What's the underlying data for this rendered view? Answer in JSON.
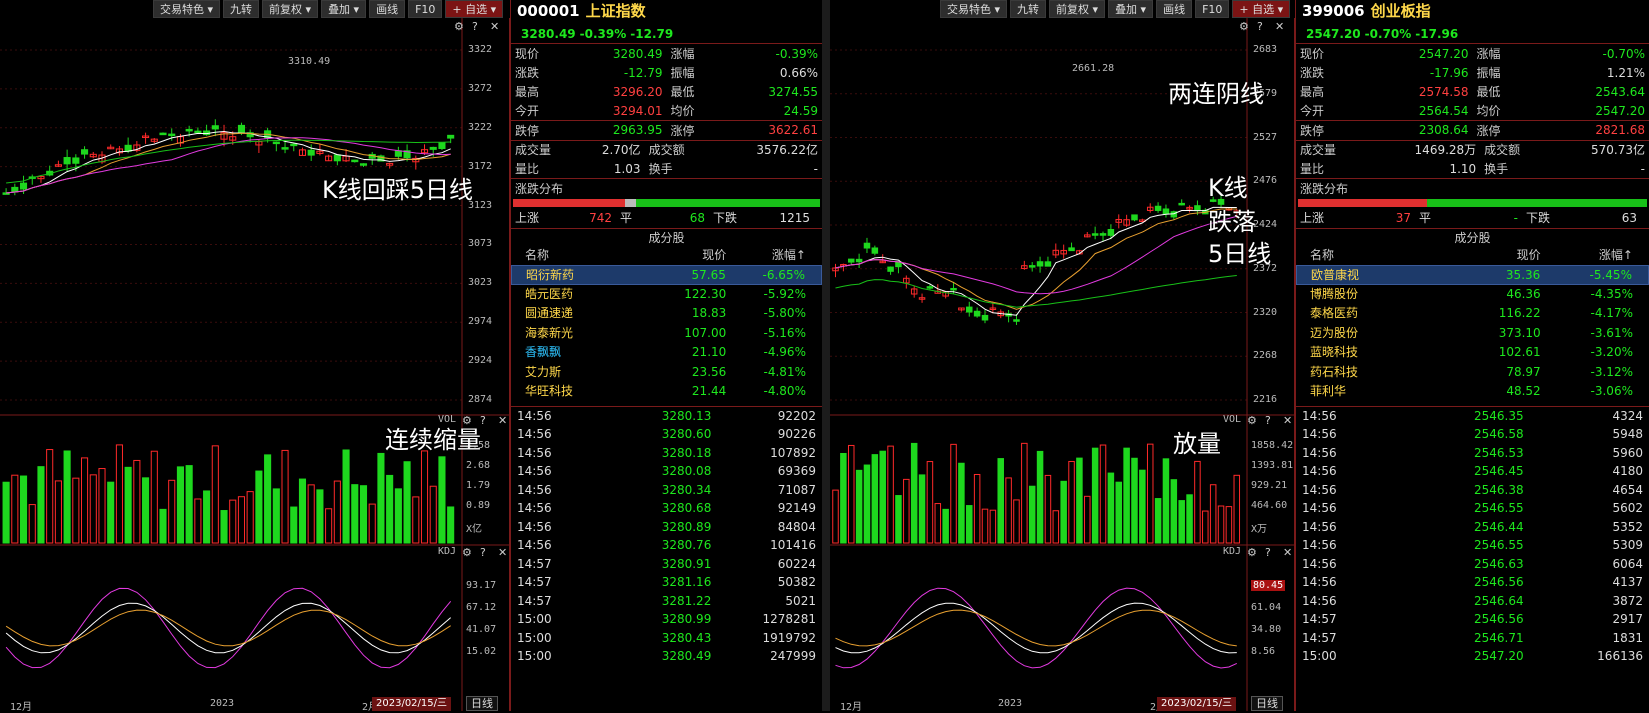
{
  "left": {
    "toolbar": [
      "交易特色 ▾",
      "九转",
      "前复权 ▾",
      "叠加 ▾",
      "画线",
      "F10"
    ],
    "toolbar_add": "+ 自选 ▾",
    "code": "000001",
    "name": "上证指数",
    "price_line": {
      "price": "3280.49",
      "pct": "-0.39%",
      "chg": "-12.79"
    },
    "peak_label": "3310.49",
    "y_labels": [
      "3322",
      "3272",
      "3222",
      "3172",
      "3123",
      "3073",
      "3023",
      "2974",
      "2924",
      "2874"
    ],
    "vol_labels": [
      "3.58",
      "2.68",
      "1.79",
      "0.89",
      "X亿"
    ],
    "kdj_labels": [
      "93.17",
      "67.12",
      "41.07",
      "15.02"
    ],
    "date_labels": [
      "12月",
      "2023",
      "2月"
    ],
    "date_box": "2023/02/15/三",
    "period": "日线",
    "vol_tag": "VOL",
    "kdj_tag": "KDJ",
    "annotations": {
      "k": "K线回踩5日线",
      "vol": "连续缩量"
    },
    "quote": [
      {
        "k1": "现价",
        "v1": "3280.49",
        "c1": "g",
        "k2": "涨幅",
        "v2": "-0.39%",
        "c2": "g"
      },
      {
        "k1": "涨跌",
        "v1": "-12.79",
        "c1": "g",
        "k2": "振幅",
        "v2": "0.66%",
        "c2": "w"
      },
      {
        "k1": "最高",
        "v1": "3296.20",
        "c1": "r",
        "k2": "最低",
        "v2": "3274.55",
        "c2": "g"
      },
      {
        "k1": "今开",
        "v1": "3294.01",
        "c1": "r",
        "k2": "均价",
        "v2": "24.59",
        "c2": "g"
      }
    ],
    "limit": {
      "k1": "跌停",
      "v1": "2963.95",
      "k2": "涨停",
      "v2": "3622.61"
    },
    "volume": {
      "k1": "成交量",
      "v1": "2.70亿",
      "k2": "成交额",
      "v2": "3576.22亿",
      "k3": "量比",
      "v3": "1.03",
      "k4": "换手",
      "v4": "-"
    },
    "dist": {
      "title": "涨跌分布",
      "up_label": "上涨",
      "up": "742",
      "flat_label": "平",
      "flat": "68",
      "down_label": "下跌",
      "down": "1215"
    },
    "stocks_title": "成分股",
    "stocks_header": [
      "名称",
      "现价",
      "涨幅↑"
    ],
    "stocks": [
      {
        "n": "昭衍新药",
        "p": "57.65",
        "c": "-6.65%",
        "nc": "y"
      },
      {
        "n": "皓元医药",
        "p": "122.30",
        "c": "-5.92%",
        "nc": "y"
      },
      {
        "n": "圆通速递",
        "p": "18.83",
        "c": "-5.80%",
        "nc": "y"
      },
      {
        "n": "海泰新光",
        "p": "107.00",
        "c": "-5.16%",
        "nc": "y"
      },
      {
        "n": "香飘飘",
        "p": "21.10",
        "c": "-4.96%",
        "nc": "c"
      },
      {
        "n": "艾力斯",
        "p": "23.56",
        "c": "-4.81%",
        "nc": "y"
      },
      {
        "n": "华旺科技",
        "p": "21.44",
        "c": "-4.80%",
        "nc": "y"
      }
    ],
    "ticks": [
      [
        "14:56",
        "3280.13",
        "92202"
      ],
      [
        "14:56",
        "3280.60",
        "90226"
      ],
      [
        "14:56",
        "3280.18",
        "107892"
      ],
      [
        "14:56",
        "3280.08",
        "69369"
      ],
      [
        "14:56",
        "3280.34",
        "71087"
      ],
      [
        "14:56",
        "3280.68",
        "92149"
      ],
      [
        "14:56",
        "3280.89",
        "84804"
      ],
      [
        "14:56",
        "3280.76",
        "101416"
      ],
      [
        "14:57",
        "3280.91",
        "60224"
      ],
      [
        "14:57",
        "3281.16",
        "50382"
      ],
      [
        "14:57",
        "3281.22",
        "5021"
      ],
      [
        "15:00",
        "3280.99",
        "1278281"
      ],
      [
        "15:00",
        "3280.43",
        "1919792"
      ],
      [
        "15:00",
        "3280.49",
        "247999"
      ]
    ]
  },
  "right": {
    "toolbar": [
      "交易特色 ▾",
      "九转",
      "前复权 ▾",
      "叠加 ▾",
      "画线",
      "F10"
    ],
    "toolbar_add": "+ 自选 ▾",
    "code": "399006",
    "name": "创业板指",
    "price_line": {
      "price": "2547.20",
      "pct": "-0.70%",
      "chg": "-17.96"
    },
    "peak_label": "2661.28",
    "y_labels": [
      "2683",
      "2579",
      "2527",
      "2476",
      "2424",
      "2372",
      "2320",
      "2268",
      "2216"
    ],
    "vol_labels": [
      "1858.42",
      "1393.81",
      "929.21",
      "464.60",
      "X万"
    ],
    "kdj_labels": [
      "80.45",
      "61.04",
      "34.80",
      "8.56"
    ],
    "date_labels": [
      "12月",
      "2023",
      "2月"
    ],
    "date_box": "2023/02/15/三",
    "period": "日线",
    "vol_tag": "VOL",
    "kdj_tag": "KDJ",
    "annotations": {
      "top": "两连阴线",
      "k1": "K线",
      "k2": "跌落",
      "k3": "5日线",
      "vol": "放量"
    },
    "quote": [
      {
        "k1": "现价",
        "v1": "2547.20",
        "c1": "g",
        "k2": "涨幅",
        "v2": "-0.70%",
        "c2": "g"
      },
      {
        "k1": "涨跌",
        "v1": "-17.96",
        "c1": "g",
        "k2": "振幅",
        "v2": "1.21%",
        "c2": "w"
      },
      {
        "k1": "最高",
        "v1": "2574.58",
        "c1": "r",
        "k2": "最低",
        "v2": "2543.64",
        "c2": "g"
      },
      {
        "k1": "今开",
        "v1": "2564.54",
        "c1": "g",
        "k2": "均价",
        "v2": "2547.20",
        "c2": "g"
      }
    ],
    "limit": {
      "k1": "跌停",
      "v1": "2308.64",
      "k2": "涨停",
      "v2": "2821.68"
    },
    "volume": {
      "k1": "成交量",
      "v1": "1469.28万",
      "k2": "成交额",
      "v2": "570.73亿",
      "k3": "量比",
      "v3": "1.10",
      "k4": "换手",
      "v4": "-"
    },
    "dist": {
      "title": "涨跌分布",
      "up_label": "上涨",
      "up": "37",
      "flat_label": "平",
      "flat": "-",
      "down_label": "下跌",
      "down": "63"
    },
    "stocks_title": "成分股",
    "stocks_header": [
      "名称",
      "现价",
      "涨幅↑"
    ],
    "stocks": [
      {
        "n": "欧普康视",
        "p": "35.36",
        "c": "-5.45%",
        "nc": "y"
      },
      {
        "n": "博腾股份",
        "p": "46.36",
        "c": "-4.35%",
        "nc": "y"
      },
      {
        "n": "泰格医药",
        "p": "116.22",
        "c": "-4.17%",
        "nc": "y"
      },
      {
        "n": "迈为股份",
        "p": "373.10",
        "c": "-3.61%",
        "nc": "y"
      },
      {
        "n": "蓝晓科技",
        "p": "102.61",
        "c": "-3.20%",
        "nc": "y"
      },
      {
        "n": "药石科技",
        "p": "78.97",
        "c": "-3.12%",
        "nc": "y"
      },
      {
        "n": "菲利华",
        "p": "48.52",
        "c": "-3.06%",
        "nc": "y"
      }
    ],
    "ticks": [
      [
        "14:56",
        "2546.35",
        "4324"
      ],
      [
        "14:56",
        "2546.58",
        "5948"
      ],
      [
        "14:56",
        "2546.53",
        "5960"
      ],
      [
        "14:56",
        "2546.45",
        "4180"
      ],
      [
        "14:56",
        "2546.38",
        "4654"
      ],
      [
        "14:56",
        "2546.55",
        "5602"
      ],
      [
        "14:56",
        "2546.44",
        "5352"
      ],
      [
        "14:56",
        "2546.55",
        "5309"
      ],
      [
        "14:56",
        "2546.63",
        "6064"
      ],
      [
        "14:56",
        "2546.56",
        "4137"
      ],
      [
        "14:56",
        "2546.64",
        "3872"
      ],
      [
        "14:57",
        "2546.56",
        "2917"
      ],
      [
        "14:57",
        "2546.71",
        "1831"
      ],
      [
        "15:00",
        "2547.20",
        "166136"
      ]
    ]
  }
}
